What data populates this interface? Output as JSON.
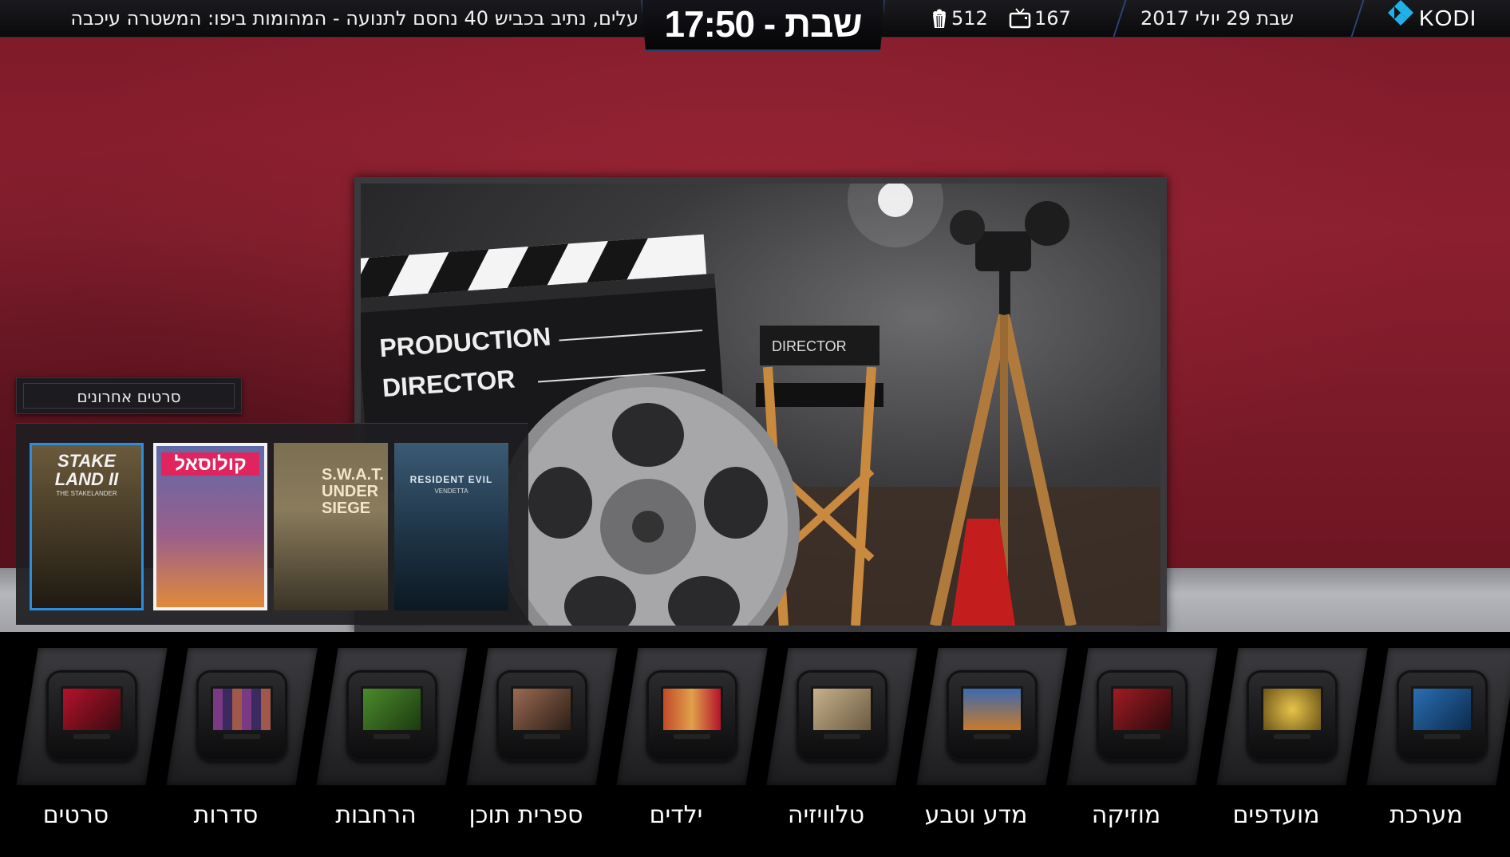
{
  "topbar": {
    "ticker": "עלים, נתיב בכביש 40 נחסם לתנועה - המהומות ביפו: המשטרה עיכבה",
    "clock": "שבת - 17:50",
    "movies_count": "512",
    "tv_count": "167",
    "date": "שבת 29 יולי 2017",
    "logo": "KODI"
  },
  "featured": {
    "slate_line1": "PRODUCTION",
    "slate_line2": "DIRECTOR",
    "chair_label": "DIRECTOR"
  },
  "recent": {
    "title": "סרטים אחרונים",
    "posters": [
      {
        "title": "STAKE LAND II",
        "subtitle": "THE STAKELANDER",
        "color": "#4e4330"
      },
      {
        "title": "קולוסאל",
        "subtitle": "",
        "color": "#3a3b66"
      },
      {
        "title": "S.W.A.T. UNDER SIEGE",
        "subtitle": "",
        "color": "#6b5d3e"
      },
      {
        "title": "RESIDENT EVIL",
        "subtitle": "VENDETTA",
        "color": "#1f3346"
      }
    ]
  },
  "menu": {
    "items": [
      {
        "label": "סרטים",
        "icon": "movies-icon",
        "accent": "#b3132a"
      },
      {
        "label": "סדרות",
        "icon": "tvshows-icon",
        "accent": "#7a3a83"
      },
      {
        "label": "הרחבות",
        "icon": "addons-icon",
        "accent": "#4b8a2c"
      },
      {
        "label": "ספרית תוכן",
        "icon": "library-icon",
        "accent": "#9a6a52"
      },
      {
        "label": "ילדים",
        "icon": "kids-icon",
        "accent": "#b3132a"
      },
      {
        "label": "טלוויזיה",
        "icon": "tv-icon",
        "accent": "#8a7658"
      },
      {
        "label": "מדע וטבע",
        "icon": "nature-icon",
        "accent": "#c97a2a"
      },
      {
        "label": "מוזיקה",
        "icon": "music-icon",
        "accent": "#a01b24"
      },
      {
        "label": "מועדפים",
        "icon": "favorites-icon",
        "accent": "#c9a63c"
      },
      {
        "label": "מערכת",
        "icon": "system-icon",
        "accent": "#2a6fb3"
      }
    ]
  }
}
